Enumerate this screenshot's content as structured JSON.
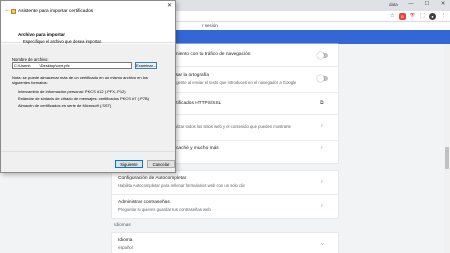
{
  "window": {
    "user": "data",
    "min_glyph": "—",
    "max_glyph": "☐",
    "close_glyph": "✕"
  },
  "toolbar": {
    "icons": [
      "star-icon",
      "brave-icon",
      "shield-icon",
      "extension-icon",
      "avatar-icon",
      "menu-icon"
    ],
    "star_glyph": "☆",
    "brave_glyph": "B",
    "shield_glyph": "⛨",
    "ext_glyph": "⬚",
    "avatar_glyph": "●",
    "kebab_glyph": "⋮"
  },
  "bookmarks": {
    "text": "r sesión"
  },
  "colors": {
    "header": "#3367d6",
    "accent": "#1a73e8"
  },
  "settings": {
    "rows_top": [
      {
        "label": "amiento con tu tráfico de navegación",
        "control": "toggle"
      },
      {
        "label": "visar la ortografía",
        "sub": "eligente al enviar el texto que introduces en el navegador a Google",
        "control": "toggle"
      },
      {
        "label": "ertificados HTTPS/SSL",
        "control": "launch"
      },
      {
        "label": "",
        "sub": "ualizar todos los sitios web y el contenido que pueden mostrarte",
        "control": "chevron"
      },
      {
        "label": "a caché y mucho más",
        "control": "chevron"
      }
    ],
    "rows_mid": [
      {
        "label": "Configuración de Autocompletar",
        "sub": "Habilita Autocompletar para rellenar formularios web con un solo clic",
        "control": "chevron"
      },
      {
        "label": "Administrar contraseñas",
        "sub": "Preguntar si quieres guardar tus contraseñas web",
        "control": "chevron"
      }
    ],
    "section_languages": "Idiomas",
    "rows_bot": [
      {
        "label": "Idioma",
        "sub": "español",
        "control": "chevron"
      }
    ],
    "chevron_glyph": "›",
    "launch_glyph": "⧉"
  },
  "dialog": {
    "title": "Asistente para importar certificados",
    "back_glyph": "←",
    "close_glyph": "✕",
    "heading": "Archivo para importar",
    "subheading": "Especifique el archivo que desea importar.",
    "field_label": "Nombre de archivo:",
    "file_value": "C:\\Users\\        \\Desktop\\cert.pfx",
    "browse_label": "Examinar...",
    "note": "Nota: se puede almacenar más de un certificado en un mismo archivo en los siguientes formatos:",
    "formats": [
      "Intercambio de información personal: PKCS #12 (.PFX,.P12)",
      "Estándar de sintaxis de cifrado de mensajes: certificados PKCS #7 (.P7B)",
      "Almacén de certificados en serie de Microsoft (.SST)"
    ],
    "next_label": "Siguiente",
    "cancel_label": "Cancelar"
  }
}
